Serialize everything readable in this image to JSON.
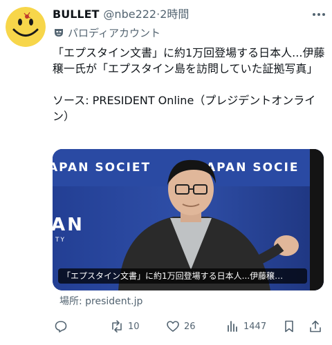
{
  "post": {
    "display_name": "BULLET",
    "handle": "@nbe222",
    "separator": "·",
    "time": "2時間",
    "account_label": "パロディアカウント",
    "text": "「エプスタイン文書」に約1万回登場する日本人...伊藤穣一氏が「エプスタイン島を訪問していた証拠写真」\n\nソース: PRESIDENT Online（プレジデントオンライン）",
    "media": {
      "banner_text": "APAN SOCIET",
      "banner_text_2": "APAN SOCIE",
      "left_letters": "AN",
      "left_small": "TY",
      "caption": "「エプスタイン文書」に約1万回登場する日本人...伊藤穣…"
    },
    "source": "場所: president.jp",
    "actions": {
      "reply_icon": "reply-icon",
      "repost_icon": "repost-icon",
      "repost_count": "10",
      "like_icon": "heart-icon",
      "like_count": "26",
      "views_icon": "views-icon",
      "views_count": "1447",
      "bookmark_icon": "bookmark-icon",
      "share_icon": "share-icon"
    }
  },
  "colors": {
    "text_primary": "#0f1419",
    "text_secondary": "#536471",
    "avatar_yellow": "#f7d64a",
    "banner_blue": "#2f4fa8"
  }
}
